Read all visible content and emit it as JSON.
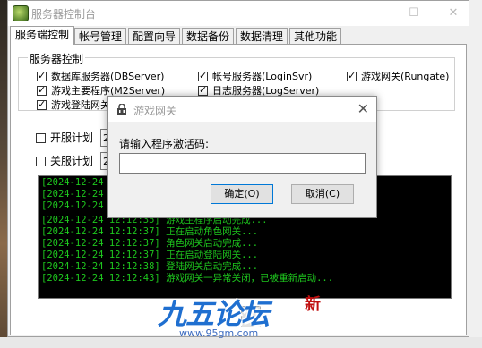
{
  "window": {
    "title": "服务器控制台",
    "minimize_glyph": "—",
    "maximize_glyph": "☐",
    "close_glyph": "✕"
  },
  "tabs": [
    {
      "label": "服务端控制",
      "active": true
    },
    {
      "label": "帐号管理"
    },
    {
      "label": "配置向导"
    },
    {
      "label": "数据备份"
    },
    {
      "label": "数据清理"
    },
    {
      "label": "其他功能"
    }
  ],
  "server_control": {
    "group_title": "服务器控制",
    "checkboxes": [
      {
        "label": "数据库服务器(DBServer)",
        "checked": true
      },
      {
        "label": "帐号服务器(LoginSvr)",
        "checked": true
      },
      {
        "label": "游戏网关(Rungate)",
        "checked": true
      },
      {
        "label": "游戏主要程序(M2Server)",
        "checked": true
      },
      {
        "label": "日志服务器(LogServer)",
        "checked": true
      },
      {
        "label": "游戏登陆网关",
        "checked": true
      }
    ],
    "open_plan": {
      "label": "开服计划",
      "checked": false,
      "value": "20"
    },
    "close_plan": {
      "label": "关服计划",
      "checked": false,
      "value": "20"
    }
  },
  "log_lines": [
    "[2024-12-24 1",
    "[2024-12-24 1",
    "[2024-12-24 1",
    "[2024-12-24 12:12:35] 游戏主程序启动完成...",
    "[2024-12-24 12:12:37] 正在启动角色网关...",
    "[2024-12-24 12:12:37] 角色网关启动完成...",
    "[2024-12-24 12:12:37] 正在启动登陆网关...",
    "[2024-12-24 12:12:38] 登陆网关启动完成...",
    "[2024-12-24 12:12:43] 游戏网关一异常关闭，已被重新启动..."
  ],
  "dialog": {
    "title": "游戏网关",
    "prompt": "请输入程序激活码:",
    "input_value": "",
    "ok_label": "确定(O)",
    "cancel_label": "取消(C)",
    "close_glyph": "✕"
  },
  "watermark": {
    "text": "九五论坛",
    "badge": "新",
    "url": "www.95gm.com"
  },
  "colors": {
    "log_text": "#1ec81e",
    "console_bg": "#000000",
    "ok_border": "#0078d7"
  }
}
